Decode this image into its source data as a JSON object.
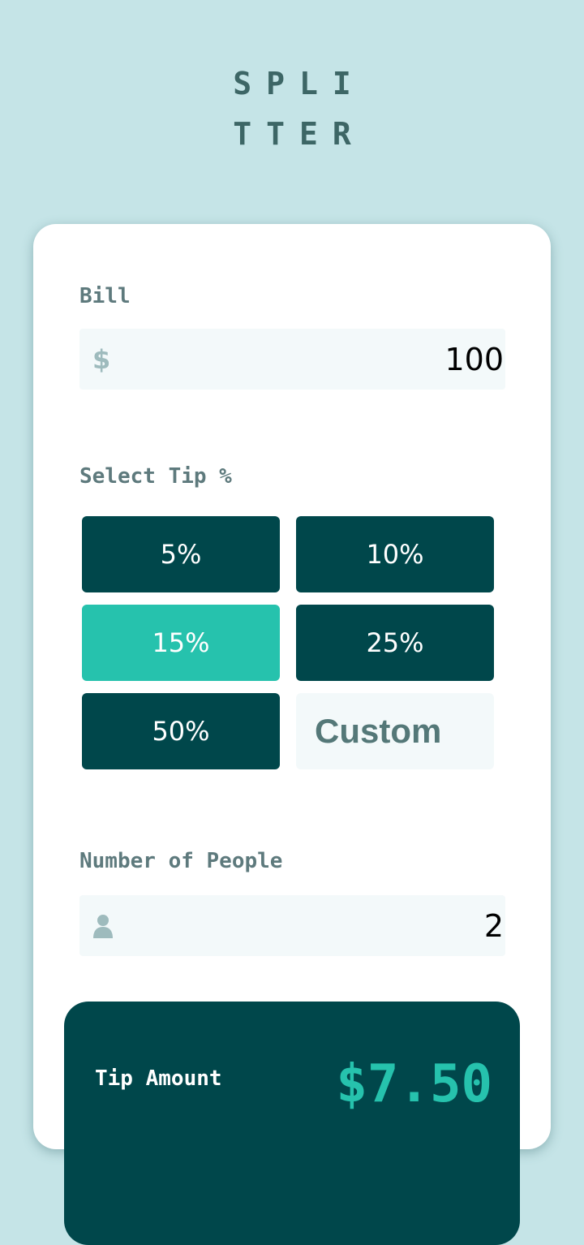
{
  "app": {
    "logo_line1": "SPLI",
    "logo_line2": "TTER"
  },
  "bill": {
    "label": "Bill",
    "currency_icon": "dollar-icon",
    "currency_symbol": "$",
    "value": "100"
  },
  "tip": {
    "label": "Select Tip %",
    "options": [
      {
        "label": "5%",
        "selected": false
      },
      {
        "label": "10%",
        "selected": false
      },
      {
        "label": "15%",
        "selected": true
      },
      {
        "label": "25%",
        "selected": false
      },
      {
        "label": "50%",
        "selected": false
      }
    ],
    "custom_label": "Custom"
  },
  "people": {
    "label": "Number of People",
    "icon": "person-icon",
    "value": "2"
  },
  "results": {
    "tip_amount_label": "Tip Amount",
    "tip_amount_value": "$7.50"
  },
  "colors": {
    "background": "#c5e4e7",
    "card": "#ffffff",
    "dark_cyan": "#00474b",
    "strong_cyan": "#26c2ad",
    "label_text": "#5e7a7d",
    "input_bg": "#f3f9fa",
    "logo_text": "#3d6666"
  }
}
